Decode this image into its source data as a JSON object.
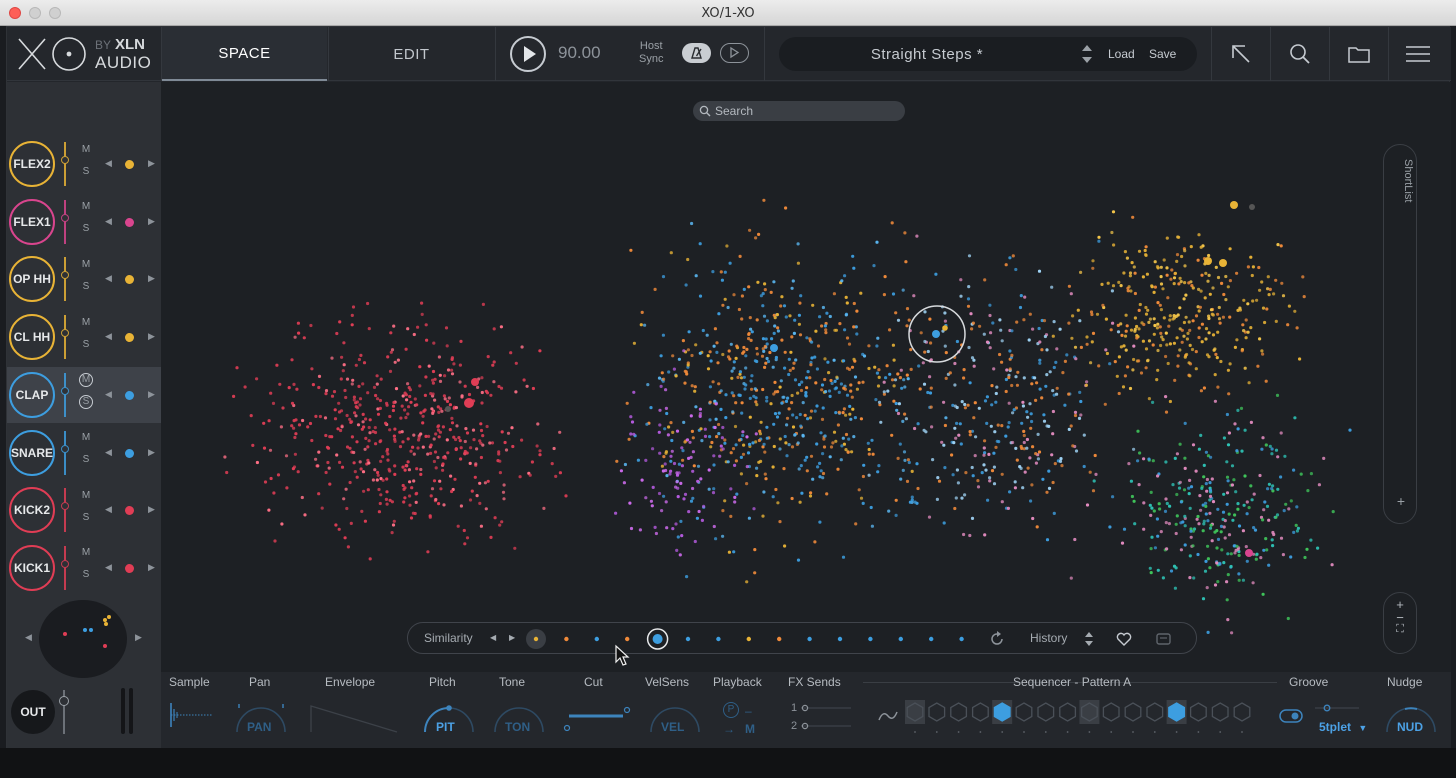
{
  "window": {
    "title": "XO/1-XO"
  },
  "logo": {
    "by": "BY",
    "brand_line1": "XLN",
    "brand_line2": "AUDIO"
  },
  "tabs": [
    {
      "label": "SPACE"
    },
    {
      "label": "EDIT"
    }
  ],
  "transport": {
    "tempo": "90.00",
    "host_sync_line1": "Host",
    "host_sync_line2": "Sync"
  },
  "preset": {
    "name": "Straight Steps *",
    "load": "Load",
    "save": "Save"
  },
  "tracks": [
    {
      "name": "FLEX2",
      "color": "#e8b336"
    },
    {
      "name": "FLEX1",
      "color": "#d9458e"
    },
    {
      "name": "OP HH",
      "color": "#e8b336"
    },
    {
      "name": "CL HH",
      "color": "#e8b336"
    },
    {
      "name": "CLAP",
      "color": "#3d9ee0"
    },
    {
      "name": "SNARE",
      "color": "#3d9ee0"
    },
    {
      "name": "KICK2",
      "color": "#e03d55"
    },
    {
      "name": "KICK1",
      "color": "#e03d55"
    }
  ],
  "mute_label": "M",
  "solo_label": "S",
  "out_label": "OUT",
  "search": {
    "placeholder": "Search"
  },
  "shortlist": {
    "label": "ShortList"
  },
  "similarity": {
    "label": "Similarity",
    "history": "History"
  },
  "bottom": {
    "labels": [
      "Sample",
      "Pan",
      "Envelope",
      "Pitch",
      "Tone",
      "Cut",
      "VelSens",
      "Playback",
      "FX Sends",
      "Sequencer - Pattern A",
      "Groove",
      "Nudge"
    ],
    "knobs": {
      "pan": "PAN",
      "pit": "PIT",
      "ton": "TON",
      "vel": "VEL",
      "nud": "NUD"
    },
    "groove_value": "5tplet",
    "playback_p": "P",
    "playback_m": "M",
    "fx1": "1",
    "fx2": "2"
  },
  "colors": {
    "accent": "#3d84bd",
    "kick": "#e03d55",
    "snare_clap": "#3d9ee0",
    "hats": "#e8b336",
    "flex1": "#d9458e",
    "green": "#3fc45a"
  }
}
